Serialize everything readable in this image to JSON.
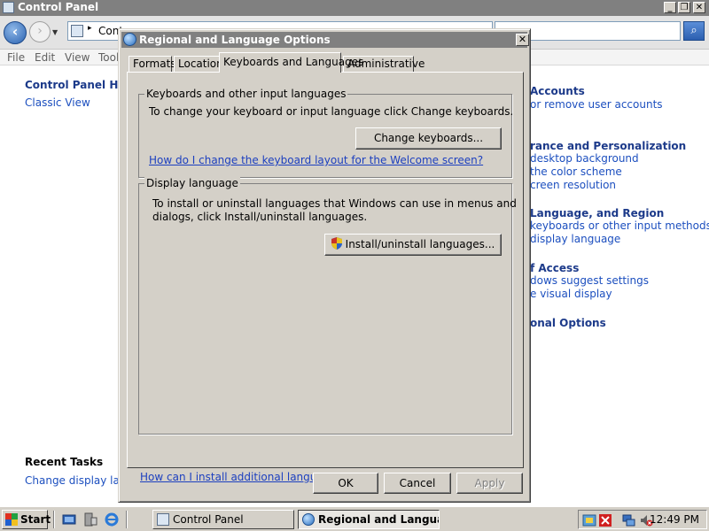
{
  "control_panel": {
    "title": "Control Panel",
    "address_text": "Cont",
    "menu": [
      "File",
      "Edit",
      "View",
      "Tools"
    ],
    "home_link": "Control Panel Home",
    "classic_view": "Classic View",
    "recent_tasks_heading": "Recent Tasks",
    "recent_task_1": "Change display language",
    "categories": [
      {
        "text": "Accounts",
        "head": true
      },
      {
        "text": "or remove user accounts",
        "head": false
      },
      {
        "text": "rance and Personalization",
        "head": true
      },
      {
        "text": "desktop background",
        "head": false
      },
      {
        "text": "the color scheme",
        "head": false
      },
      {
        "text": "creen resolution",
        "head": false
      },
      {
        "text": "Language, and Region",
        "head": true
      },
      {
        "text": "keyboards or other input methods",
        "head": false
      },
      {
        "text": "display language",
        "head": false
      },
      {
        "text": "f Access",
        "head": true
      },
      {
        "text": "dows suggest settings",
        "head": false
      },
      {
        "text": "e visual display",
        "head": false
      },
      {
        "text": "onal Options",
        "head": true
      }
    ]
  },
  "dialog": {
    "title": "Regional and Language Options",
    "close_symbol": "✕",
    "tabs": [
      "Formats",
      "Location",
      "Keyboards and Languages",
      "Administrative"
    ],
    "active_tab": "Keyboards and Languages",
    "keyboards_group": {
      "label": "Keyboards and other input languages",
      "description": "To change your keyboard or input language click Change keyboards.",
      "button": "Change keyboards...",
      "link": "How do I change the keyboard layout for the Welcome screen?"
    },
    "display_group": {
      "label": "Display language",
      "description_line1": "To install or uninstall languages that Windows can use in menus and",
      "description_line2": "dialogs, click Install/uninstall languages.",
      "button": "Install/uninstall languages..."
    },
    "bottom_link": "How can I install additional languages?",
    "ok": "OK",
    "cancel": "Cancel",
    "apply": "Apply"
  },
  "taskbar": {
    "start": "Start",
    "tasks": [
      "Control Panel",
      "Regional and Langua..."
    ],
    "clock": "12:49 PM"
  },
  "colors": {
    "link": "#1c3fbf",
    "titlebar_inactive": "#808080",
    "dialog_face": "#d4d0c8"
  }
}
